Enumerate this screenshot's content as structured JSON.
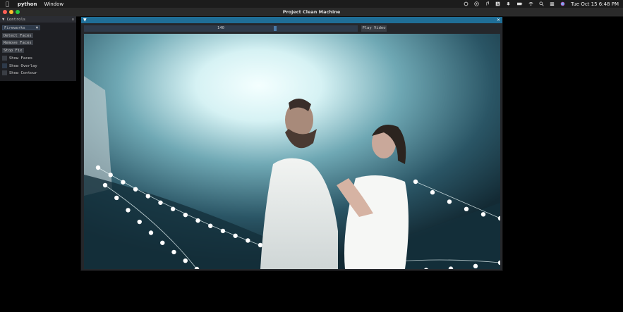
{
  "menubar": {
    "app_name": "python",
    "menu_items": [
      "Window"
    ],
    "clock": "Tue Oct 15  6:48 PM"
  },
  "window": {
    "title": "Project Clean Machine",
    "traffic_colors": [
      "#fe5f57",
      "#febc2e",
      "#28c840"
    ]
  },
  "controls": {
    "header": "▼ Controls",
    "combo_value": "Fireworks",
    "buttons": [
      "Detect Faces",
      "Remove Faces",
      "Stop Fix"
    ],
    "checkboxes": [
      {
        "label": "Show Faces",
        "checked": false
      },
      {
        "label": "Show Overlay",
        "checked": true
      },
      {
        "label": "Show Contour",
        "checked": false
      }
    ]
  },
  "video": {
    "slider_value": "140",
    "slider_fraction": 0.7,
    "play_label": "Play Video"
  },
  "colors": {
    "accent": "#1f6e97",
    "panel_bg": "#1d1e22",
    "widget_bg": "#2e3a4a"
  }
}
